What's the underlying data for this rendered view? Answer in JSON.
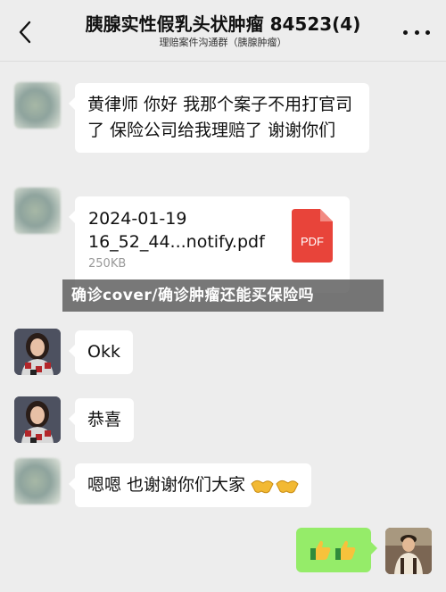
{
  "header": {
    "title": "胰腺实性假乳头状肿瘤 84523(4)",
    "subtitle": "理赔案件沟通群（胰腺肿瘤）"
  },
  "messages": [
    {
      "text": "黄律师 你好 我那个案子不用打官司了 保险公司给我理赔了 谢谢你们"
    },
    {
      "file": {
        "name": "2024-01-19 16_52_44...notify.pdf",
        "size": "250KB",
        "type": "PDF"
      }
    },
    {
      "text": "Okk"
    },
    {
      "text": "恭喜"
    },
    {
      "text": "嗯嗯 也谢谢你们大家"
    }
  ],
  "banner": {
    "text": "确诊cover/确诊肿瘤还能买保险吗"
  },
  "colors": {
    "self_bubble": "#95ec69",
    "other_bubble": "#ffffff",
    "pdf_red": "#e8443a"
  }
}
